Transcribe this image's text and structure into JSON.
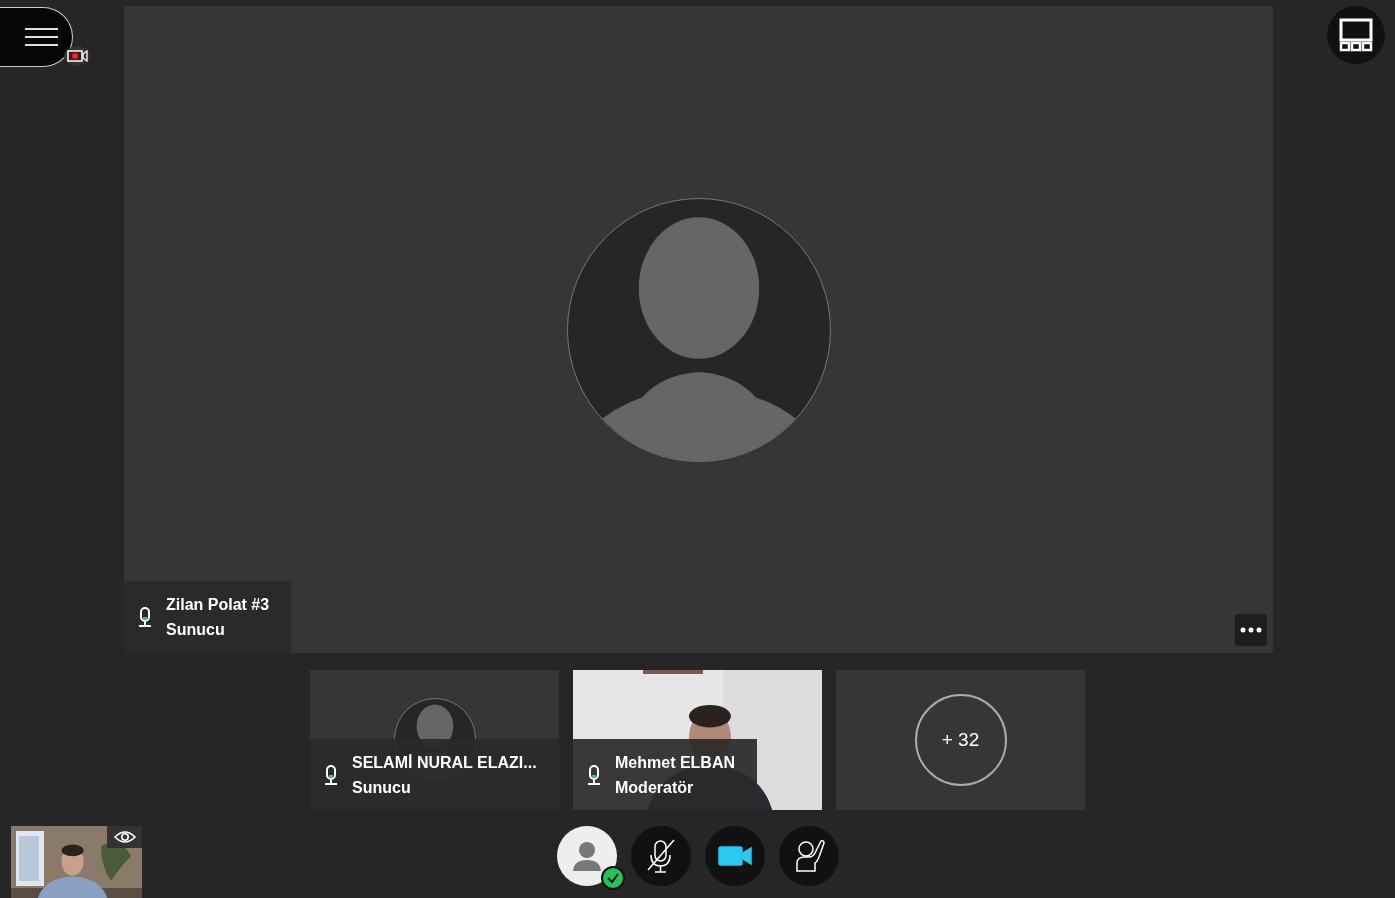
{
  "recording": true,
  "stage": {
    "kind": "avatar",
    "name": "Zilan Polat #3",
    "role": "Sunucu"
  },
  "tiles": [
    {
      "kind": "avatar",
      "name": "SELAMİ NURAL ELAZI...",
      "role": "Sunucu"
    },
    {
      "kind": "video",
      "name": "Mehmet ELBAN",
      "role": "Moderatör"
    },
    {
      "kind": "more",
      "count": "+ 32"
    }
  ],
  "controls": [
    {
      "kind": "status",
      "on": true
    },
    {
      "kind": "mic",
      "on": false
    },
    {
      "kind": "camera",
      "on": true
    },
    {
      "kind": "hand",
      "on": false
    }
  ]
}
